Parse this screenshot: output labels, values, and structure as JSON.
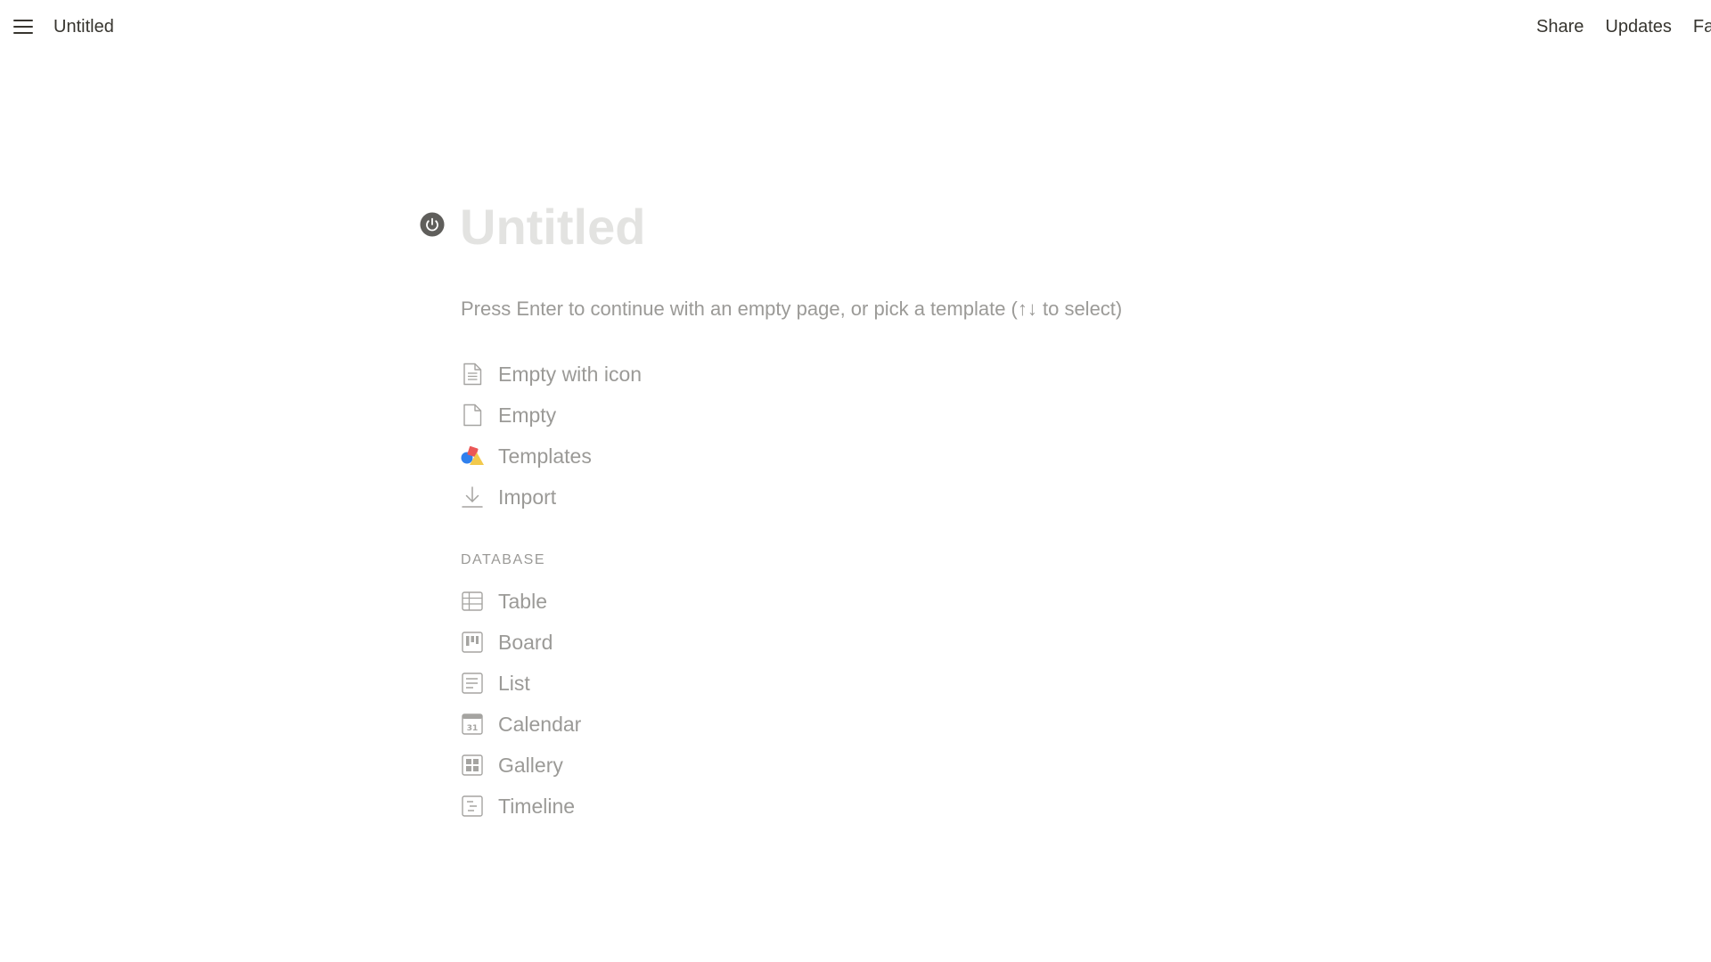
{
  "topbar": {
    "title": "Untitled",
    "actions": {
      "share": "Share",
      "updates": "Updates",
      "favorite_partial": "Fa"
    }
  },
  "page": {
    "title_placeholder": "Untitled",
    "hint": "Press Enter to continue with an empty page, or pick a template (↑↓ to select)"
  },
  "options": [
    {
      "label": "Empty with icon",
      "icon": "page-with-text-icon"
    },
    {
      "label": "Empty",
      "icon": "blank-page-icon"
    },
    {
      "label": "Templates",
      "icon": "templates-shapes-icon"
    },
    {
      "label": "Import",
      "icon": "import-download-icon"
    }
  ],
  "database": {
    "label": "DATABASE",
    "items": [
      {
        "label": "Table",
        "icon": "table-icon"
      },
      {
        "label": "Board",
        "icon": "board-icon"
      },
      {
        "label": "List",
        "icon": "list-icon"
      },
      {
        "label": "Calendar",
        "icon": "calendar-icon",
        "icon_text": "31"
      },
      {
        "label": "Gallery",
        "icon": "gallery-icon"
      },
      {
        "label": "Timeline",
        "icon": "timeline-icon"
      }
    ]
  },
  "colors": {
    "text": "#37352f",
    "muted": "#9b9a97",
    "title_placeholder": "#e3e3e1",
    "icon_gray": "#a5a4a1",
    "templates_blue": "#2f80ed",
    "templates_red": "#eb5757",
    "templates_yellow": "#f2c94c"
  }
}
